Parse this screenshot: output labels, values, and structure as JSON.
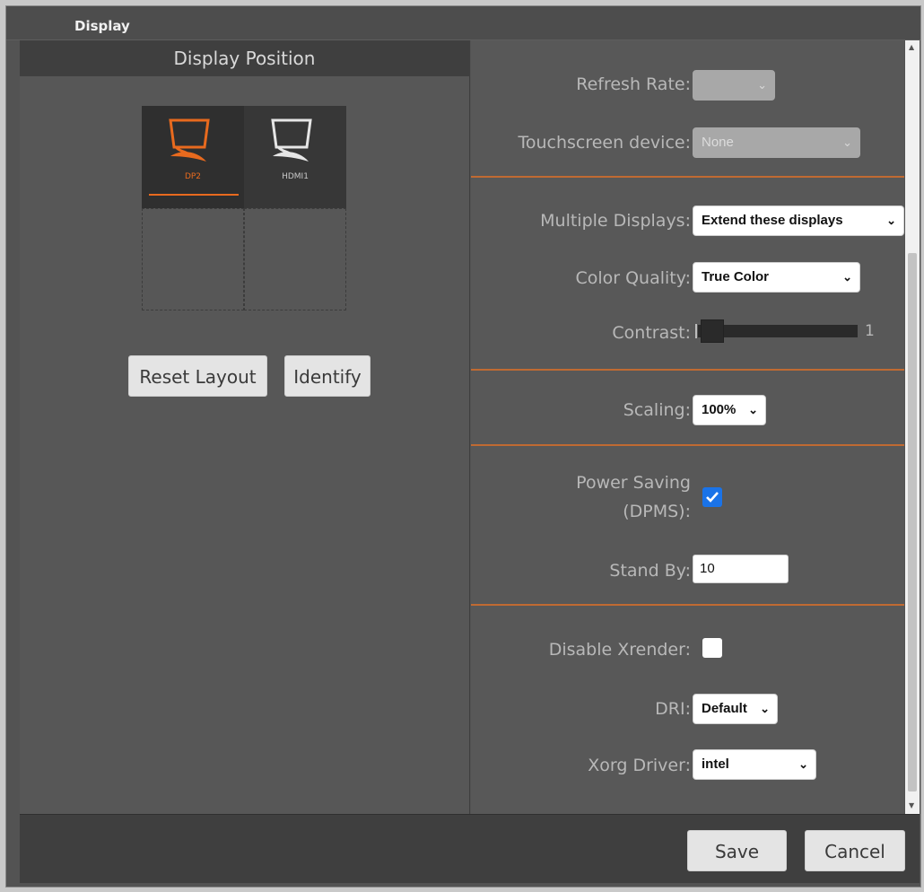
{
  "window": {
    "title": "Display"
  },
  "left": {
    "header": "Display Position",
    "displays": [
      {
        "label": "DP2",
        "active": true
      },
      {
        "label": "HDMI1",
        "active": false
      }
    ],
    "reset_label": "Reset Layout",
    "identify_label": "Identify"
  },
  "right": {
    "refresh_rate": {
      "label": "Refresh Rate:",
      "value": ""
    },
    "touchscreen": {
      "label": "Touchscreen device:",
      "value": "None"
    },
    "multiple_displays": {
      "label": "Multiple Displays:",
      "value": "Extend these displays"
    },
    "color_quality": {
      "label": "Color Quality:",
      "value": "True Color"
    },
    "contrast": {
      "label": "Contrast:",
      "value": "1"
    },
    "scaling": {
      "label": "Scaling:",
      "value": "100%"
    },
    "power_saving": {
      "label_line1": "Power Saving",
      "label_line2": "(DPMS):",
      "checked": true
    },
    "stand_by": {
      "label": "Stand By:",
      "value": "10"
    },
    "disable_xrender": {
      "label": "Disable Xrender:",
      "checked": false
    },
    "dri": {
      "label": "DRI:",
      "value": "Default"
    },
    "xorg_driver": {
      "label": "Xorg Driver:",
      "value": "intel"
    }
  },
  "footer": {
    "save_label": "Save",
    "cancel_label": "Cancel"
  },
  "colors": {
    "accent": "#e86a1e",
    "checkbox_blue": "#1a73e8",
    "panel": "#575757"
  }
}
